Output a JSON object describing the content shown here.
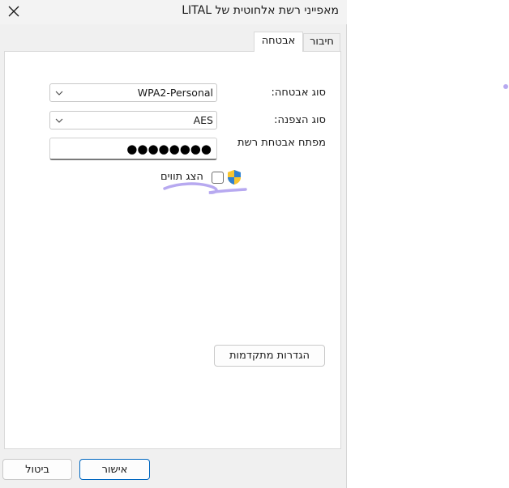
{
  "window": {
    "title": "מאפייני רשת אלחוטית של LITAL"
  },
  "tabs": [
    {
      "label": "חיבור",
      "active": false
    },
    {
      "label": "אבטחה",
      "active": true
    }
  ],
  "security": {
    "security_type_label": "סוג אבטחה:",
    "security_type_value": "WPA2-Personal",
    "encryption_type_label": "סוג הצפנה:",
    "encryption_type_value": "AES",
    "network_key_label": "מפתח אבטחת רשת",
    "network_key_value": "●●●●●●●●",
    "show_characters_label": "הצג תווים",
    "show_characters_checked": false,
    "advanced_settings_label": "הגדרות מתקדמות"
  },
  "footer": {
    "ok_label": "אישור",
    "cancel_label": "ביטול"
  },
  "colors": {
    "accent": "#0067c0",
    "annotation": "#b7a9f0"
  }
}
